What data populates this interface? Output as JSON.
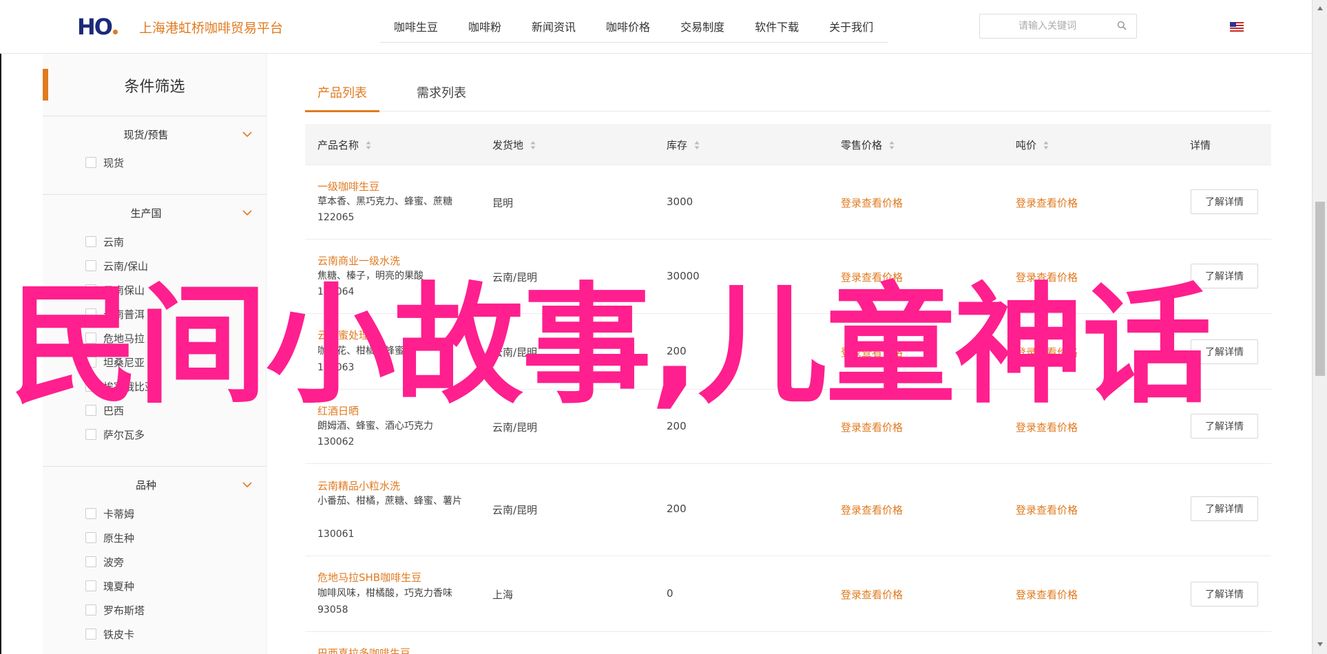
{
  "header": {
    "logo_text": "HO",
    "site_name": "上海港虹桥咖啡贸易平台",
    "nav": [
      "咖啡生豆",
      "咖啡粉",
      "新闻资讯",
      "咖啡价格",
      "交易制度",
      "软件下载",
      "关于我们"
    ],
    "search_placeholder": "请输入关键词"
  },
  "sidebar": {
    "title": "条件筛选",
    "groups": [
      {
        "name": "现货/预售",
        "options": [
          "现货"
        ]
      },
      {
        "name": "生产国",
        "options": [
          "云南",
          "云南/保山",
          "云南保山",
          "云南普洱",
          "危地马拉",
          "坦桑尼亚",
          "埃塞俄比亚",
          "巴西",
          "萨尔瓦多"
        ]
      },
      {
        "name": "品种",
        "options": [
          "卡蒂姆",
          "原生种",
          "波旁",
          "瑰夏种",
          "罗布斯塔",
          "铁皮卡"
        ]
      }
    ]
  },
  "tabs": [
    "产品列表",
    "需求列表"
  ],
  "table": {
    "headers": [
      "产品名称",
      "发货地",
      "库存",
      "零售价格",
      "吨价",
      "详情"
    ],
    "rows": [
      {
        "name": "一级咖啡生豆",
        "desc": "草本香、黑巧克力、蜂蜜、蔗糖",
        "code": "122065",
        "origin": "昆明",
        "stock": "3000",
        "retail": "登录查看价格",
        "ton": "登录查看价格",
        "detail": "了解详情"
      },
      {
        "name": "云南商业一级水洗",
        "desc": "焦糖、榛子，明亮的果酸",
        "code": "130064",
        "origin": "云南/昆明",
        "stock": "30000",
        "retail": "登录查看价格",
        "ton": "登录查看价格",
        "detail": "了解详情"
      },
      {
        "name": "云南蜜处理",
        "desc": "咖啡花、柑橘、蜂蜜",
        "code": "130063",
        "origin": "云南/昆明",
        "stock": "200",
        "retail": "登录查看价格",
        "ton": "登录查看价格",
        "detail": "了解详情"
      },
      {
        "name": "红酒日晒",
        "desc": "朗姆酒、蜂蜜、酒心巧克力",
        "code": "130062",
        "origin": "云南/昆明",
        "stock": "200",
        "retail": "登录查看价格",
        "ton": "登录查看价格",
        "detail": "了解详情"
      },
      {
        "name": "云南精品小粒水洗",
        "desc": "小番茄、柑橘，蔗糖、蜂蜜、薯片",
        "code": "130061",
        "origin": "云南/昆明",
        "stock": "200",
        "retail": "登录查看价格",
        "ton": "登录查看价格",
        "detail": "了解详情"
      },
      {
        "name": "危地马拉SHB咖啡生豆",
        "desc": "咖啡风味，柑橘酸，巧克力香味",
        "code": "93058",
        "origin": "上海",
        "stock": "0",
        "retail": "登录查看价格",
        "ton": "登录查看价格",
        "detail": "了解详情"
      }
    ],
    "partial_row_name": "巴西喜拉多咖啡生豆"
  },
  "overlay_text": "民间小故事,儿童神话",
  "colors": {
    "accent": "#e07a1f",
    "overlay": "#ff1f8e",
    "brand": "#1b2a7a"
  }
}
